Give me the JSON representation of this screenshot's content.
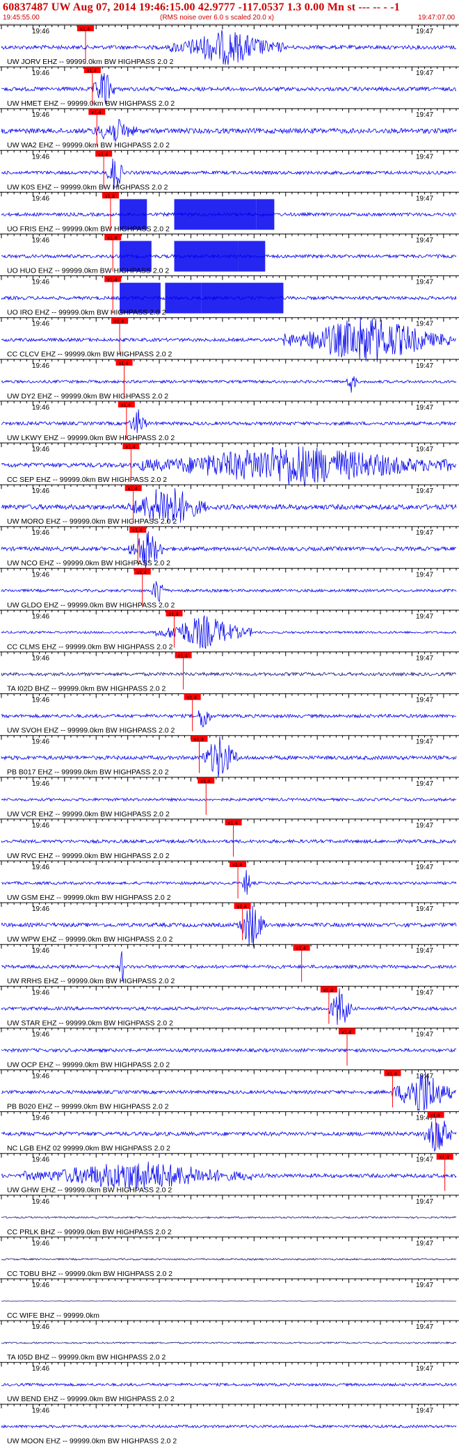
{
  "header": {
    "title": "60837487 UW Aug 07, 2014 19:46:15.00   42.9777 -117.0537  1.3 0.00 Mn st --- -- -   -1",
    "time_start": "19:45:55.00",
    "rms_note": "(RMS noise over 6.0 s scaled 20.0 x)",
    "time_end": "19:47:07.00"
  },
  "tick_labels": {
    "left": "19:46",
    "right": "19:47"
  },
  "pick_label": "x1.4",
  "colors": {
    "trace": "#0000ee",
    "trace_dark": "#1a1a80",
    "pick": "#ff0000",
    "text": "#000000",
    "header": "#cc0000"
  },
  "channels": [
    {
      "label": "UW JORV EHZ -- 99999.0km BW  HIGHPASS  2.0  2",
      "pick": 0.185,
      "amp": 0.35,
      "burst": [
        0.37,
        0.62,
        0.6
      ],
      "sat": null
    },
    {
      "label": "UW HMET EHZ -- 99999.0km BW  HIGHPASS  2.0  2",
      "pick": 0.2,
      "amp": 0.35,
      "burst": [
        0.2,
        0.25,
        0.7
      ],
      "sat": null
    },
    {
      "label": "UW WA2 EHZ -- 99999.0km BW  HIGHPASS  2.0  2",
      "pick": 0.21,
      "amp": 0.45,
      "burst": [
        0.2,
        0.3,
        0.4
      ],
      "sat": null
    },
    {
      "label": "UW K0S EHZ -- 99999.0km BW  HIGHPASS  2.0  2",
      "pick": 0.225,
      "amp": 0.3,
      "burst": [
        0.23,
        0.27,
        0.7
      ],
      "sat": null
    },
    {
      "label": "UO FRIS EHZ -- 99999.0km BW  HIGHPASS  2.0  2",
      "pick": 0.24,
      "amp": 0.3,
      "burst": null,
      "sat": [
        [
          0.26,
          0.32
        ],
        [
          0.38,
          0.56
        ],
        [
          0.56,
          0.6
        ]
      ]
    },
    {
      "label": "UO HUO EHZ -- 99999.0km BW  HIGHPASS  2.0  2",
      "pick": 0.245,
      "amp": 0.3,
      "burst": null,
      "sat": [
        [
          0.26,
          0.33
        ],
        [
          0.38,
          0.52
        ],
        [
          0.52,
          0.58
        ]
      ]
    },
    {
      "label": "UO IRO EHZ -- 99999.0km BW  HIGHPASS  2.0  2",
      "pick": 0.245,
      "amp": 0.3,
      "burst": null,
      "sat": [
        [
          0.26,
          0.35
        ],
        [
          0.36,
          0.44
        ],
        [
          0.44,
          0.62
        ]
      ]
    },
    {
      "label": "CC CLCV EHZ -- 99999.0km BW  HIGHPASS  2.0  2",
      "pick": 0.26,
      "amp": 0.3,
      "burst": [
        0.62,
        0.99,
        0.85
      ],
      "sat": null
    },
    {
      "label": "UW DY2 EHZ -- 99999.0km BW  HIGHPASS  2.0  2",
      "pick": 0.27,
      "amp": 0.25,
      "burst": [
        0.76,
        0.78,
        0.5
      ],
      "sat": null
    },
    {
      "label": "UW LKWY EHZ -- 99999.0km BW  HIGHPASS  2.0  2",
      "pick": 0.275,
      "amp": 0.3,
      "burst": [
        0.28,
        0.32,
        0.5
      ],
      "sat": null
    },
    {
      "label": "CC SEP EHZ -- 99999.0km BW  HIGHPASS  2.0  2",
      "pick": 0.285,
      "amp": 0.4,
      "burst": [
        0.3,
        0.99,
        0.7
      ],
      "sat": null
    },
    {
      "label": "UW MORO EHZ -- 99999.0km BW  HIGHPASS  2.0  2",
      "pick": 0.29,
      "amp": 0.45,
      "burst": [
        0.28,
        0.45,
        0.8
      ],
      "sat": null
    },
    {
      "label": "UW NCO EHZ -- 99999.0km BW  HIGHPASS  2.0  2",
      "pick": 0.3,
      "amp": 0.35,
      "burst": [
        0.28,
        0.36,
        0.7
      ],
      "sat": null
    },
    {
      "label": "UW GLDO EHZ -- 99999.0km BW  HIGHPASS  2.0  2",
      "pick": 0.31,
      "amp": 0.25,
      "burst": [
        0.33,
        0.36,
        0.6
      ],
      "sat": null
    },
    {
      "label": "CC CLMS EHZ -- 99999.0km BW  HIGHPASS  2.0  2",
      "pick": 0.38,
      "amp": 0.2,
      "burst": [
        0.34,
        0.55,
        0.6
      ],
      "sat": null
    },
    {
      "label": "TA I02D BHZ -- 99999.0km BW  HIGHPASS  2.0  2",
      "pick": 0.4,
      "amp": 0.3,
      "burst": null,
      "sat": null,
      "dark": true
    },
    {
      "label": "UW SVOH EHZ -- 99999.0km BW  HIGHPASS  2.0  2",
      "pick": 0.42,
      "amp": 0.3,
      "burst": [
        0.43,
        0.46,
        0.6
      ],
      "sat": null
    },
    {
      "label": "PB B017 EHZ -- 99999.0km BW  HIGHPASS  2.0  2",
      "pick": 0.435,
      "amp": 0.35,
      "burst": [
        0.44,
        0.52,
        0.8
      ],
      "sat": null
    },
    {
      "label": "UW VCR EHZ -- 99999.0km BW  HIGHPASS  2.0  2",
      "pick": 0.45,
      "amp": 0.25,
      "burst": null,
      "sat": null
    },
    {
      "label": "UW RVC EHZ -- 99999.0km BW  HIGHPASS  2.0  2",
      "pick": 0.51,
      "amp": 0.3,
      "burst": null,
      "sat": null
    },
    {
      "label": "UW GSM EHZ -- 99999.0km BW  HIGHPASS  2.0  2",
      "pick": 0.52,
      "amp": 0.25,
      "burst": [
        0.53,
        0.55,
        0.6
      ],
      "sat": null
    },
    {
      "label": "UW WPW EHZ -- 99999.0km BW  HIGHPASS  2.0  2",
      "pick": 0.53,
      "amp": 0.35,
      "burst": [
        0.52,
        0.58,
        0.9
      ],
      "sat": null
    },
    {
      "label": "UW RRHS EHZ -- 99999.0km BW  HIGHPASS  2.0  2",
      "pick": 0.66,
      "amp": 0.3,
      "burst": [
        0.26,
        0.27,
        0.7
      ],
      "sat": null
    },
    {
      "label": "UW STAR EHZ -- 99999.0km BW  HIGHPASS  2.0  2",
      "pick": 0.72,
      "amp": 0.3,
      "burst": [
        0.72,
        0.77,
        0.8
      ],
      "sat": null
    },
    {
      "label": "UW OCP EHZ -- 99999.0km BW  HIGHPASS  2.0  2",
      "pick": 0.76,
      "amp": 0.3,
      "burst": null,
      "sat": null
    },
    {
      "label": "PB B020 EHZ -- 99999.0km BW  HIGHPASS  2.0  2",
      "pick": 0.86,
      "amp": 0.3,
      "burst": [
        0.86,
        0.99,
        0.9
      ],
      "sat": null
    },
    {
      "label": "NC LGB EHZ 02 99999.0km BW  HIGHPASS  2.0  2",
      "pick": 0.955,
      "amp": 0.35,
      "burst": [
        0.93,
        0.99,
        0.8
      ],
      "sat": null
    },
    {
      "label": "UW GHW EHZ -- 99999.0km BW  HIGHPASS  2.0  2",
      "pick": 0.975,
      "amp": 0.35,
      "burst": [
        0.05,
        0.55,
        0.5
      ],
      "sat": null
    },
    {
      "label": "CC PRLK BHZ -- 99999.0km BW  HIGHPASS  2.0  2",
      "pick": null,
      "amp": 0.15,
      "burst": null,
      "sat": null,
      "dark": true
    },
    {
      "label": "CC TOBU BHZ -- 99999.0km BW  HIGHPASS  2.0  2",
      "pick": null,
      "amp": 0.15,
      "burst": null,
      "sat": null,
      "dark": true
    },
    {
      "label": "CC WIFE BHZ -- 99999.0km",
      "pick": null,
      "amp": 0.0,
      "burst": null,
      "sat": null,
      "dark": true,
      "flat": true
    },
    {
      "label": "TA I05D BHZ -- 99999.0km BW  HIGHPASS  2.0  2",
      "pick": null,
      "amp": 0.15,
      "burst": null,
      "sat": null,
      "dark": true
    },
    {
      "label": "UW BEND EHZ -- 99999.0km BW  HIGHPASS  2.0  2",
      "pick": null,
      "amp": 0.25,
      "burst": null,
      "sat": null
    },
    {
      "label": "UW MOON EHZ -- 99999.0km BW  HIGHPASS  2.0  2",
      "pick": null,
      "amp": 0.25,
      "burst": null,
      "sat": null
    }
  ]
}
